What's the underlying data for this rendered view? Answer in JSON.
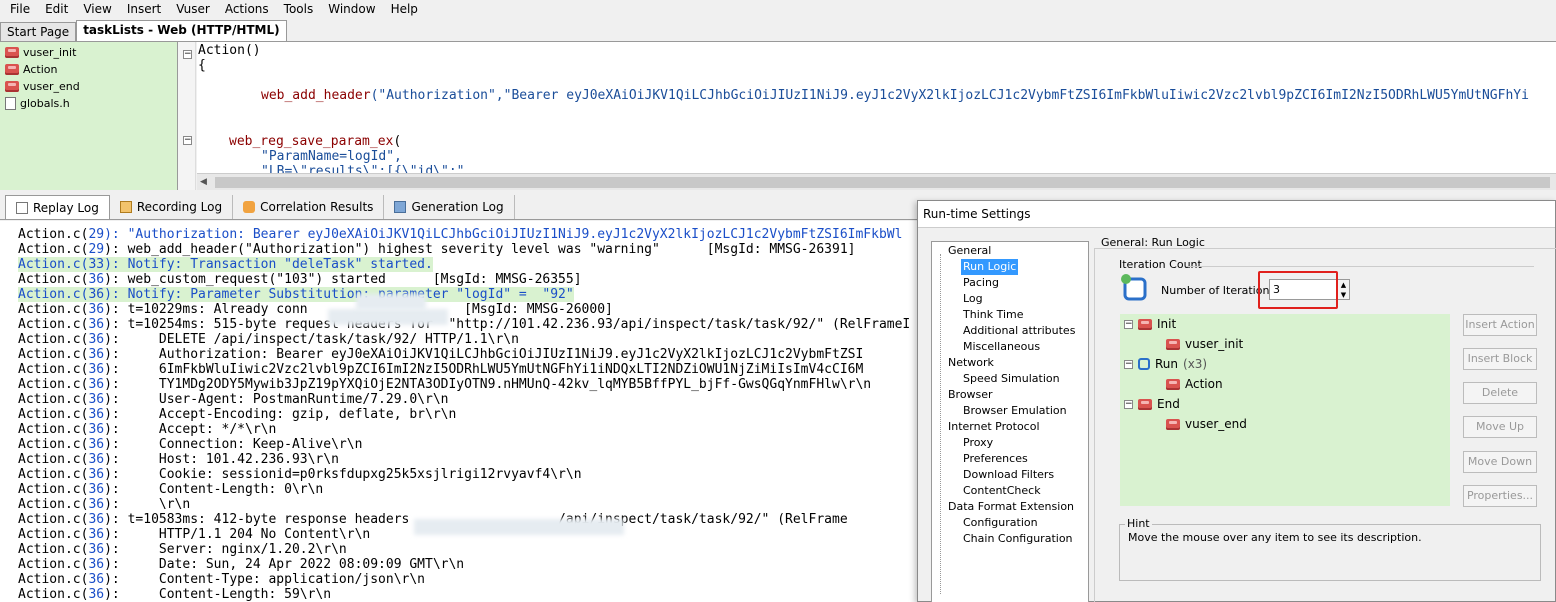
{
  "menu": [
    "File",
    "Edit",
    "View",
    "Insert",
    "Vuser",
    "Actions",
    "Tools",
    "Window",
    "Help"
  ],
  "doc_tabs": [
    "Start Page",
    "taskLists - Web (HTTP/HTML)"
  ],
  "script_tree": [
    "vuser_init",
    "Action",
    "vuser_end",
    "globals.h"
  ],
  "editor": {
    "line1": "Action()",
    "line2": "{",
    "header_fn": "web_add_header",
    "header_args": "(\"Authorization\",\"Bearer eyJ0eXAiOiJKV1QiLCJhbGciOiJIUzI1NiJ9.eyJ1c2VyX2lkIjozLCJ1c2VybmFtZSI6ImFkbWluIiwic2Vzc2lvbl9pZCI6ImI2NzI5ODRhLWU5YmUtNGFhYi",
    "save_fn": "web_reg_save_param_ex",
    "save_open": "(",
    "param_name": "\"ParamName=logId\",",
    "lb_line": "\"LB=\\\"results\\\":[{\\\"id\\\":\","
  },
  "log_tabs": [
    "Replay Log",
    "Recording Log",
    "Correlation Results",
    "Generation Log"
  ],
  "log_lines": [
    {
      "prefix": "Action.c(",
      "num": "29",
      "text": "): \"Authorization: Bearer eyJ0eXAiOiJKV1QiLCJhbGciOiJIUzI1NiJ9.eyJ1c2VyX2lkIjozLCJ1c2VybmFtZSI6ImFkbWl",
      "hl": false,
      "blue": true
    },
    {
      "prefix": "Action.c(",
      "num": "29",
      "text": "): web_add_header(\"Authorization\") highest severity level was \"warning\"      [MsgId: MMSG-26391]",
      "hl": false,
      "blue": false
    },
    {
      "prefix": "Action.c(",
      "num": "33",
      "text": "): Notify: Transaction \"deleTask\" started.",
      "hl": true,
      "blue": false
    },
    {
      "prefix": "Action.c(",
      "num": "36",
      "text": "): web_custom_request(\"103\") started      [MsgId: MMSG-26355]",
      "hl": false,
      "blue": false
    },
    {
      "prefix": "Action.c(",
      "num": "36",
      "text": "): Notify: Parameter Substitution: parameter \"logId\" =  \"92\"",
      "hl": true,
      "blue": false
    },
    {
      "prefix": "Action.c(",
      "num": "36",
      "text": "): t=10229ms: Already conn                    [MsgId: MMSG-26000]",
      "hl": false,
      "blue": false
    },
    {
      "prefix": "Action.c(",
      "num": "36",
      "text": "): t=10254ms: 515-byte request headers for  \"http://101.42.236.93/api/inspect/task/task/92/\" (RelFrameI",
      "hl": false,
      "blue": false
    },
    {
      "prefix": "Action.c(",
      "num": "36",
      "text": "):     DELETE /api/inspect/task/task/92/ HTTP/1.1\\r\\n",
      "hl": false,
      "blue": false
    },
    {
      "prefix": "Action.c(",
      "num": "36",
      "text": "):     Authorization: Bearer eyJ0eXAiOiJKV1QiLCJhbGciOiJIUzI1NiJ9.eyJ1c2VyX2lkIjozLCJ1c2VybmFtZSI",
      "hl": false,
      "blue": false
    },
    {
      "prefix": "Action.c(",
      "num": "36",
      "text": "):     6ImFkbWluIiwic2Vzc2lvbl9pZCI6ImI2NzI5ODRhLWU5YmUtNGFhYi1iNDQxLTI2NDZiOWU1NjZiMiIsImV4cCI6M",
      "hl": false,
      "blue": false
    },
    {
      "prefix": "Action.c(",
      "num": "36",
      "text": "):     TY1MDg2ODY5Mywib3JpZ19pYXQiOjE2NTA3ODIyOTN9.nHMUnQ-42kv_lqMYB5BffPYL_bjFf-GwsQGqYnmFHlw\\r\\n",
      "hl": false,
      "blue": false
    },
    {
      "prefix": "Action.c(",
      "num": "36",
      "text": "):     User-Agent: PostmanRuntime/7.29.0\\r\\n",
      "hl": false,
      "blue": false
    },
    {
      "prefix": "Action.c(",
      "num": "36",
      "text": "):     Accept-Encoding: gzip, deflate, br\\r\\n",
      "hl": false,
      "blue": false
    },
    {
      "prefix": "Action.c(",
      "num": "36",
      "text": "):     Accept: */*\\r\\n",
      "hl": false,
      "blue": false
    },
    {
      "prefix": "Action.c(",
      "num": "36",
      "text": "):     Connection: Keep-Alive\\r\\n",
      "hl": false,
      "blue": false
    },
    {
      "prefix": "Action.c(",
      "num": "36",
      "text": "):     Host: 101.42.236.93\\r\\n",
      "hl": false,
      "blue": false
    },
    {
      "prefix": "Action.c(",
      "num": "36",
      "text": "):     Cookie: sessionid=p0rksfdupxg25k5xsjlrigi12rvyavf4\\r\\n",
      "hl": false,
      "blue": false
    },
    {
      "prefix": "Action.c(",
      "num": "36",
      "text": "):     Content-Length: 0\\r\\n",
      "hl": false,
      "blue": false
    },
    {
      "prefix": "Action.c(",
      "num": "36",
      "text": "):     \\r\\n",
      "hl": false,
      "blue": false
    },
    {
      "prefix": "Action.c(",
      "num": "36",
      "text": "): t=10583ms: 412-byte response headers                   /api/inspect/task/task/92/\" (RelFrame",
      "hl": false,
      "blue": false
    },
    {
      "prefix": "Action.c(",
      "num": "36",
      "text": "):     HTTP/1.1 204 No Content\\r\\n",
      "hl": false,
      "blue": false
    },
    {
      "prefix": "Action.c(",
      "num": "36",
      "text": "):     Server: nginx/1.20.2\\r\\n",
      "hl": false,
      "blue": false
    },
    {
      "prefix": "Action.c(",
      "num": "36",
      "text": "):     Date: Sun, 24 Apr 2022 08:09:09 GMT\\r\\n",
      "hl": false,
      "blue": false
    },
    {
      "prefix": "Action.c(",
      "num": "36",
      "text": "):     Content-Type: application/json\\r\\n",
      "hl": false,
      "blue": false
    },
    {
      "prefix": "Action.c(",
      "num": "36",
      "text": "):     Content-Length: 59\\r\\n",
      "hl": false,
      "blue": false
    }
  ],
  "dialog": {
    "title": "Run-time Settings",
    "nav": {
      "general": "General",
      "run_logic": "Run Logic",
      "pacing": "Pacing",
      "log": "Log",
      "think_time": "Think Time",
      "additional_attributes": "Additional attributes",
      "miscellaneous": "Miscellaneous",
      "network": "Network",
      "speed_simulation": "Speed Simulation",
      "browser": "Browser",
      "browser_emulation": "Browser Emulation",
      "internet_protocol": "Internet Protocol",
      "proxy": "Proxy",
      "preferences": "Preferences",
      "download_filters": "Download Filters",
      "content_check": "ContentCheck",
      "data_format_extension": "Data Format Extension",
      "configuration": "Configuration",
      "chain_configuration": "Chain Configuration"
    },
    "section_title": "General: Run Logic",
    "iteration_count_label": "Iteration Count",
    "number_of_iterations_label": "Number of Iterations",
    "number_of_iterations_value": "3",
    "logic_tree": {
      "init": "Init",
      "vuser_init": "vuser_init",
      "run": "Run",
      "run_count": "(x3)",
      "action": "Action",
      "end": "End",
      "vuser_end": "vuser_end"
    },
    "buttons": {
      "insert_action": "Insert Action",
      "insert_block": "Insert Block",
      "delete": "Delete",
      "move_up": "Move Up",
      "move_down": "Move Down",
      "properties": "Properties..."
    },
    "hint_label": "Hint",
    "hint_text": "Move the mouse over any item to see its description."
  },
  "colors": {
    "tree_green": "#d9f2d0",
    "selection_blue": "#3399ff",
    "highlight_red": "#e0201c",
    "log_blue": "#1a4ec8"
  }
}
